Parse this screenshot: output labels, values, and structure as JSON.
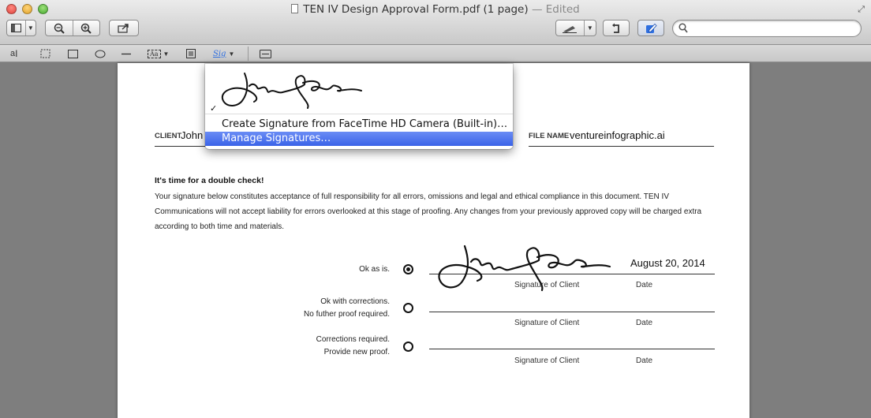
{
  "window": {
    "title": "TEN IV Design Approval Form.pdf (1 page)",
    "edited": "— Edited"
  },
  "toolbar": {
    "search_placeholder": ""
  },
  "markup": {
    "text_tool": "a",
    "text_tool_cursor": "I",
    "text_box": "Aa",
    "sign_tool": "Sig"
  },
  "form": {
    "client_label": "CLIENT",
    "client_value": "John",
    "file_label": "FILE NAME",
    "file_value": "ventureinfographic.ai",
    "heading": "It's time for a double check!",
    "body": "Your signature below constitutes acceptance of full responsibility for all errors, omissions and legal and ethical compliance in this document. TEN IV Communications will not accept liability for errors overlooked at this stage of proofing. Any changes from your previously approved copy will be charged extra according to both time and materials.",
    "options": [
      {
        "line1": "Ok as is.",
        "line2": "",
        "selected": true,
        "date": "August 20, 2014"
      },
      {
        "line1": "Ok with corrections.",
        "line2": "No futher proof required.",
        "selected": false,
        "date": ""
      },
      {
        "line1": "Corrections required.",
        "line2": "Provide new proof.",
        "selected": false,
        "date": ""
      }
    ],
    "sig_caption": "Signature of Client",
    "date_caption": "Date"
  },
  "signature_menu": {
    "check": "✓",
    "create_label": "Create Signature from FaceTime HD Camera (Built-in)…",
    "manage_label": "Manage Signatures…"
  },
  "colors": {
    "menu_highlight": "#3a63e8",
    "annotate_active": "#2f6fe0"
  }
}
